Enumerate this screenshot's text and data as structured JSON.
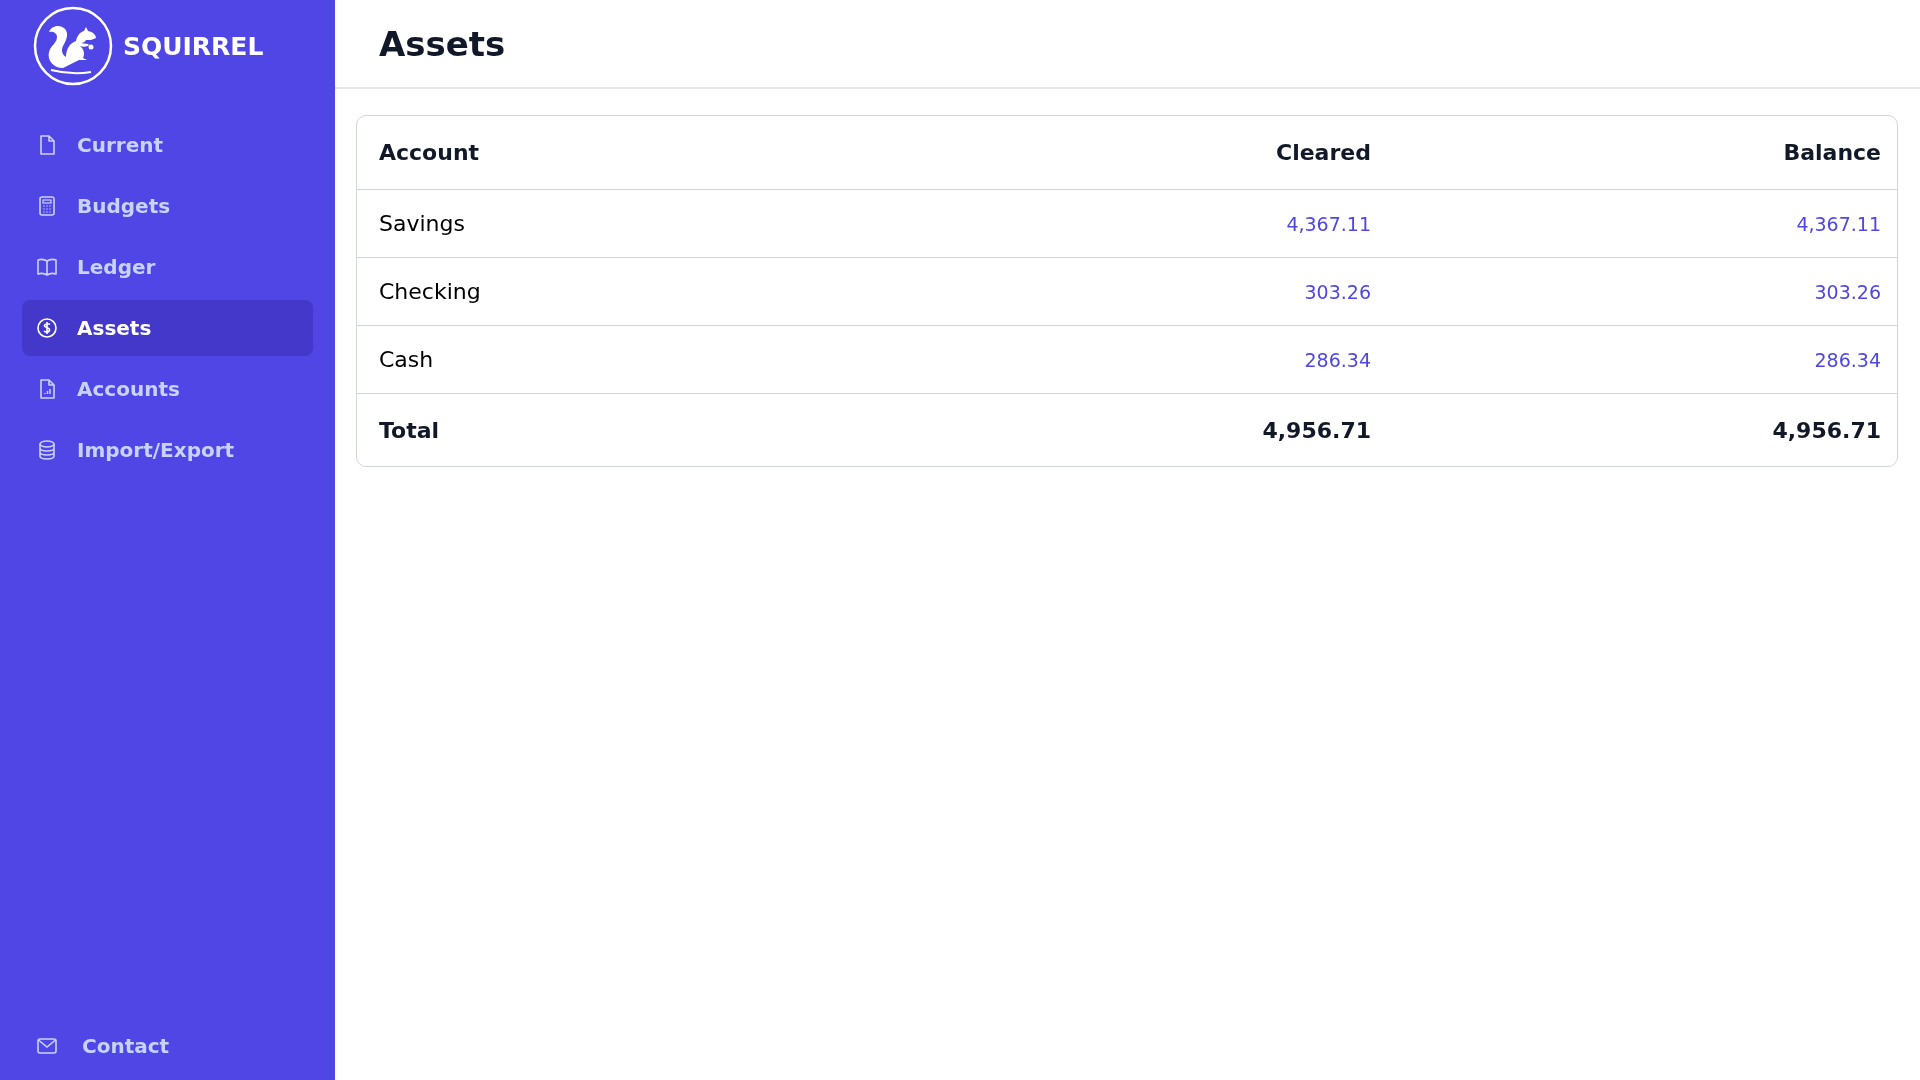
{
  "brand": "SQUIRREL",
  "nav": [
    {
      "label": "Current",
      "selected": false
    },
    {
      "label": "Budgets",
      "selected": false
    },
    {
      "label": "Ledger",
      "selected": false
    },
    {
      "label": "Assets",
      "selected": true
    },
    {
      "label": "Accounts",
      "selected": false
    },
    {
      "label": "Import/Export",
      "selected": false
    }
  ],
  "contact": {
    "label": "Contact"
  },
  "page_title": "Assets",
  "table": {
    "columns": [
      "Account",
      "Cleared",
      "Balance"
    ],
    "rows": [
      {
        "account": "Savings",
        "cleared": "4,367.11",
        "balance": "4,367.11"
      },
      {
        "account": "Checking",
        "cleared": "303.26",
        "balance": "303.26"
      },
      {
        "account": "Cash",
        "cleared": "286.34",
        "balance": "286.34"
      }
    ],
    "total": {
      "label": "Total",
      "cleared": "4,956.71",
      "balance": "4,956.71"
    }
  }
}
